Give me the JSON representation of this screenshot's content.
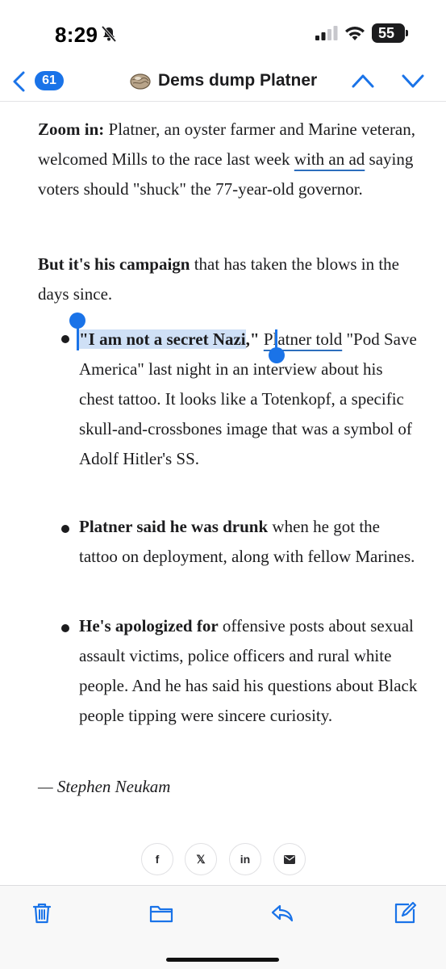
{
  "status_bar": {
    "time": "8:29",
    "battery": "55"
  },
  "nav": {
    "back_count": "61",
    "title": "Dems dump Platner"
  },
  "article": {
    "p1": {
      "bold": "Zoom in:",
      "text1": " Platner, an oyster farmer and Marine veteran, welcomed Mills to the race last week ",
      "link": "with an ad",
      "text2": " saying voters should \"shuck\" the 77-year-old governor."
    },
    "p2": {
      "bold": "But it's his campaign",
      "text": " that has taken the blows in the days since."
    },
    "bullets": [
      {
        "selected_quote": "\"I am not a secret Nazi",
        "quote_end": ",\"",
        "link": "Platner told",
        "text": " \"Pod Save America\" last night in an interview about his chest tattoo. It looks like a Totenkopf, a specific skull-and-crossbones image that was a symbol of Adolf Hitler's SS."
      },
      {
        "bold": "Platner said he was drunk",
        "text": " when he got the tattoo on deployment, along with fellow Marines."
      },
      {
        "bold": "He's apologized for",
        "text": " offensive posts about sexual assault victims, police officers and rural white people. And he has said his questions about Black people tipping were sincere curiosity."
      }
    ],
    "byline": "— Stephen Neukam"
  },
  "share": {
    "facebook": "f",
    "x": "𝕏",
    "linkedin": "in"
  },
  "colors": {
    "accent": "#1a73e8",
    "selection": "#cfe0f6",
    "link_underline": "#2c6ebd"
  },
  "toolbar": {
    "icons": [
      "trash-icon",
      "folder-icon",
      "reply-icon",
      "compose-icon"
    ]
  }
}
